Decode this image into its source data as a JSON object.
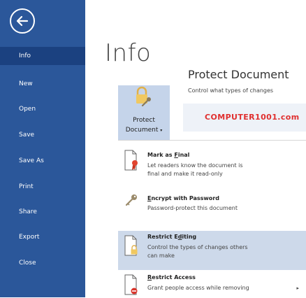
{
  "sidebar": {
    "items": [
      {
        "label": "Info"
      },
      {
        "label": "New"
      },
      {
        "label": "Open"
      },
      {
        "label": "Save"
      },
      {
        "label": "Save As"
      },
      {
        "label": "Print"
      },
      {
        "label": "Share"
      },
      {
        "label": "Export"
      },
      {
        "label": "Close"
      }
    ],
    "active": "Info"
  },
  "page": {
    "title": "Info"
  },
  "protect": {
    "button_label_line1": "Protect",
    "button_label_line2": "Document",
    "heading": "Protect Document",
    "description": "Control what types of changes"
  },
  "watermark": "COMPUTER1001.com",
  "menu": {
    "items": [
      {
        "title_prefix": "Mark as ",
        "title_key": "F",
        "title_rest": "inal",
        "desc": [
          "Let readers know the document is",
          "final and make it read-only"
        ],
        "icon": "document-ribbon-icon"
      },
      {
        "title_prefix": "",
        "title_key": "E",
        "title_rest": "ncrypt with Password",
        "desc": [
          "Password-protect this document"
        ],
        "icon": "key-icon"
      },
      {
        "title_prefix": "Restrict E",
        "title_key": "d",
        "title_rest": "iting",
        "desc": [
          "Control the types of changes others",
          "can make"
        ],
        "icon": "document-lock-icon"
      },
      {
        "title_prefix": "",
        "title_key": "R",
        "title_rest": "estrict Access",
        "desc": [
          "Grant people access while removing"
        ],
        "icon": "document-block-icon"
      }
    ],
    "submenu_arrow": "▸"
  },
  "colors": {
    "sidebar": "#2b579a",
    "sidebar_active": "#1b4180",
    "highlight": "#cdd9ea",
    "watermark": "#e03030"
  }
}
